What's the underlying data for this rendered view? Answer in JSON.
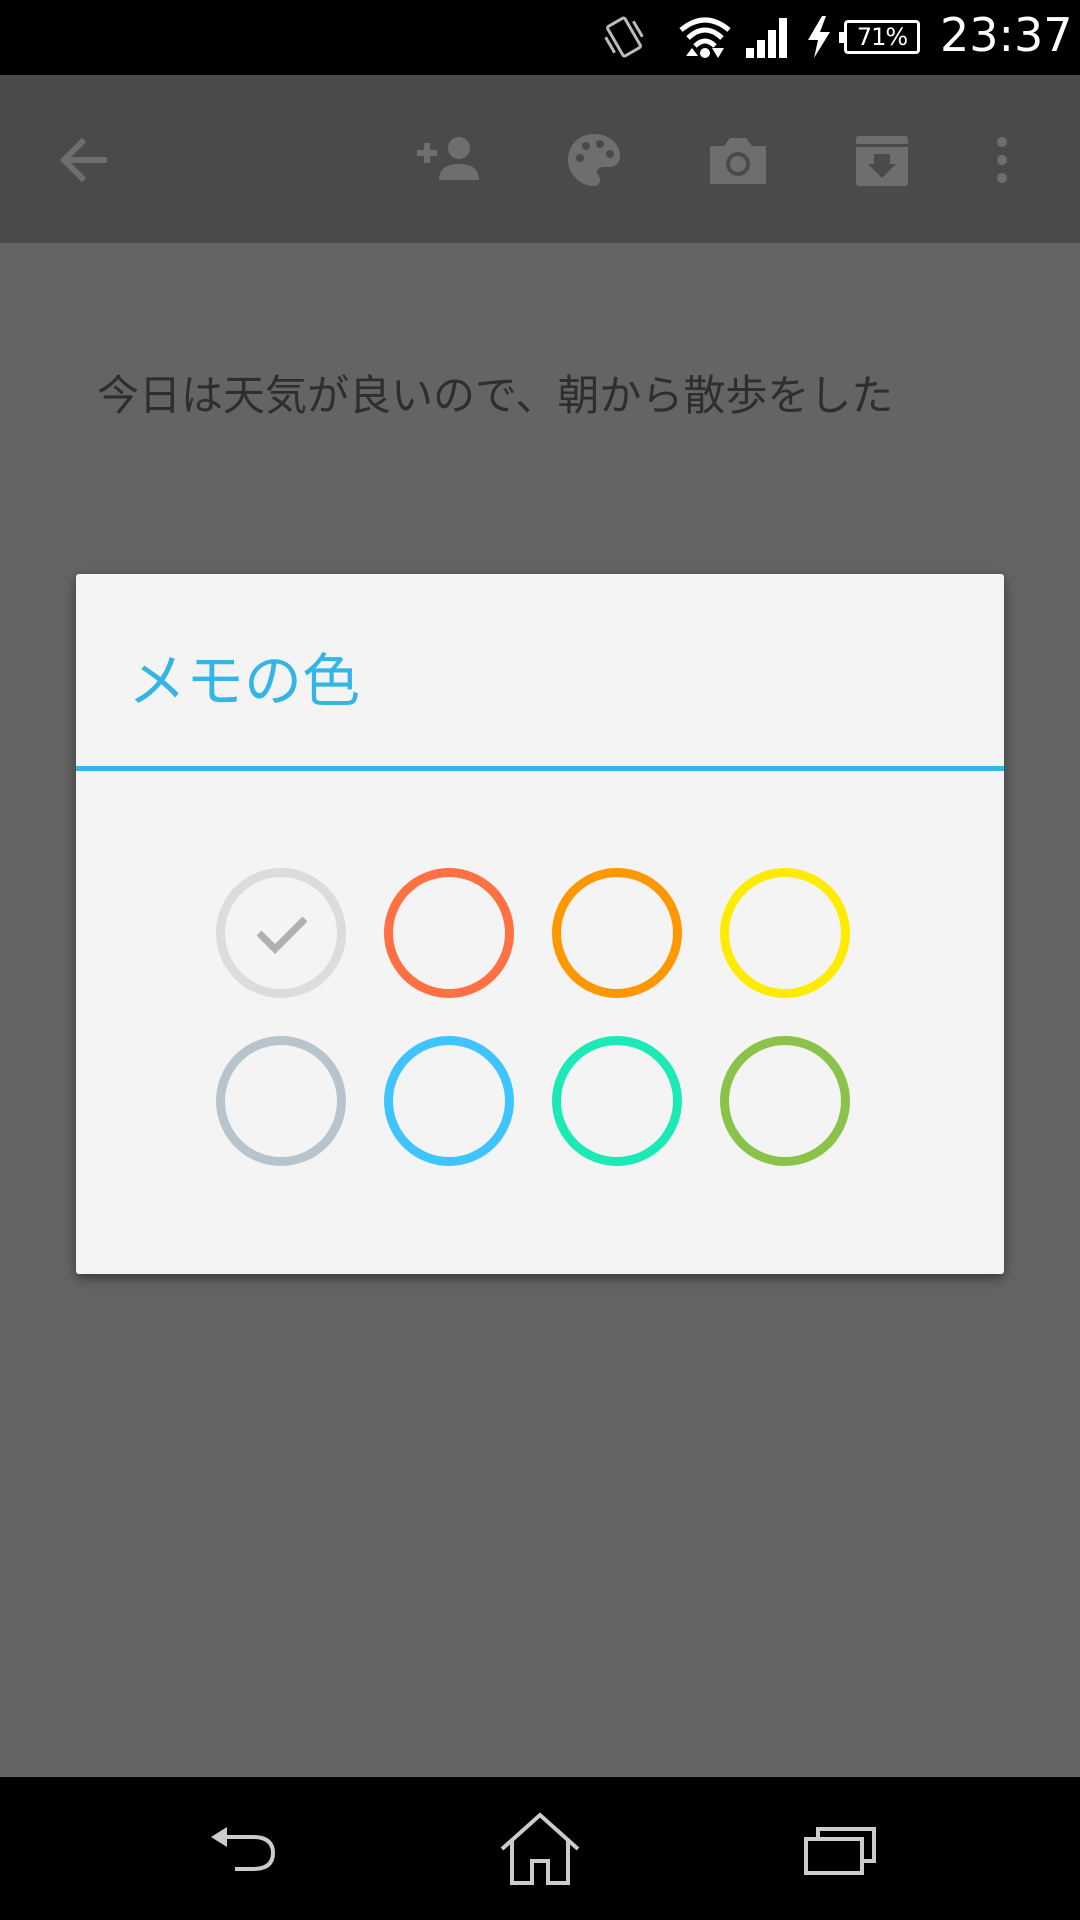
{
  "status_bar": {
    "battery_label": "71%",
    "time": "23:37",
    "icons": [
      "vibrate-icon",
      "wifi-icon",
      "signal-icon",
      "charging-icon",
      "battery-icon"
    ]
  },
  "toolbar": {
    "icons": [
      "back-arrow-icon",
      "add-collaborator-icon",
      "palette-icon",
      "camera-icon",
      "archive-icon",
      "more-vert-icon"
    ]
  },
  "note": {
    "text": "今日は天気が良いので、朝から散歩をした"
  },
  "dialog": {
    "title": "メモの色",
    "accent_color": "#33b5e5",
    "swatches": [
      {
        "name": "white",
        "color": "#dcdcdc",
        "selected": true
      },
      {
        "name": "red",
        "color": "#ff7043",
        "selected": false
      },
      {
        "name": "orange",
        "color": "#ff9800",
        "selected": false
      },
      {
        "name": "yellow",
        "color": "#ffeb00",
        "selected": false
      },
      {
        "name": "gray",
        "color": "#b8c4cb",
        "selected": false
      },
      {
        "name": "blue",
        "color": "#40c4ff",
        "selected": false
      },
      {
        "name": "teal",
        "color": "#1de9b6",
        "selected": false
      },
      {
        "name": "green",
        "color": "#8bc34a",
        "selected": false
      }
    ]
  },
  "nav_bar": {
    "icons": [
      "nav-back-icon",
      "nav-home-icon",
      "nav-recents-icon"
    ]
  }
}
